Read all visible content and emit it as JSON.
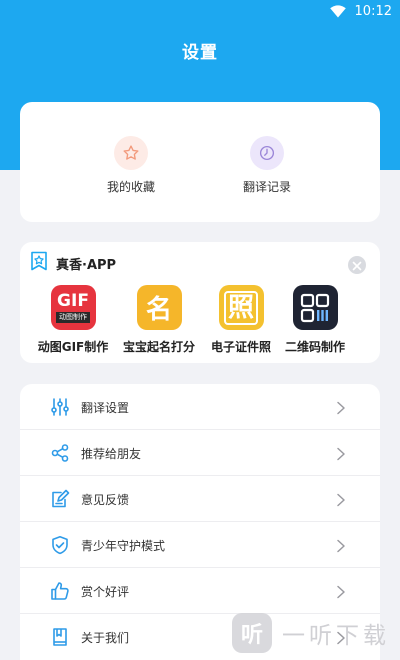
{
  "status_bar": {
    "time": "10:12"
  },
  "header": {
    "title": "设置"
  },
  "quick_actions": [
    {
      "label": "我的收藏",
      "icon": "star-icon",
      "bg": "#fdebe6",
      "color": "#f29a7c"
    },
    {
      "label": "翻译记录",
      "icon": "clock-icon",
      "bg": "#ece6fb",
      "color": "#9b86d8"
    }
  ],
  "apps_section": {
    "title": "真香·APP",
    "apps": [
      {
        "label": "动图GIF制作",
        "icon": "gif-maker-icon",
        "icon_text": "GIF",
        "icon_subtext": "动图制作",
        "bg": "#e6343e"
      },
      {
        "label": "宝宝起名打分",
        "icon": "baby-naming-icon",
        "icon_text": "名",
        "bg": "#f5b62a"
      },
      {
        "label": "电子证件照",
        "icon": "id-photo-icon",
        "icon_text": "照",
        "bg": "#f4c12f"
      },
      {
        "label": "二维码制作",
        "icon": "qr-code-icon",
        "bg": "#1f2433"
      }
    ]
  },
  "menu": [
    {
      "label": "翻译设置",
      "icon": "sliders-icon"
    },
    {
      "label": "推荐给朋友",
      "icon": "share-icon"
    },
    {
      "label": "意见反馈",
      "icon": "feedback-edit-icon"
    },
    {
      "label": "青少年守护模式",
      "icon": "shield-check-icon"
    },
    {
      "label": "赏个好评",
      "icon": "thumbs-up-icon"
    },
    {
      "label": "关于我们",
      "icon": "book-icon"
    }
  ],
  "watermark": {
    "text": "一听下载",
    "logo_text": "听"
  },
  "colors": {
    "accent": "#1da8f0",
    "menu_icon": "#2f9be8"
  }
}
